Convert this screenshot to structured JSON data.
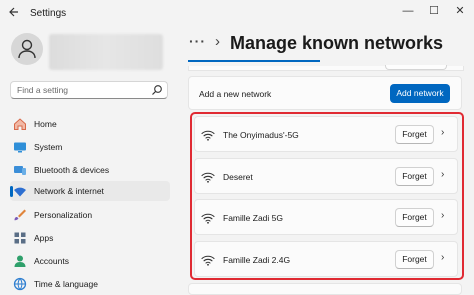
{
  "window": {
    "title": "Settings",
    "back_icon": "arrow-left-icon",
    "minimize_glyph": "—",
    "maximize_glyph": "☐",
    "close_glyph": "✕"
  },
  "search": {
    "placeholder": "Find a setting"
  },
  "sidebar": {
    "items": [
      {
        "label": "Home",
        "icon": "home-icon",
        "color": "#d86a4a"
      },
      {
        "label": "System",
        "icon": "system-icon",
        "color": "#2f8fd8"
      },
      {
        "label": "Bluetooth & devices",
        "icon": "bluetooth-icon",
        "color": "#3b8ed8"
      },
      {
        "label": "Network & internet",
        "icon": "wifi-icon",
        "color": "#2d6fd1",
        "active": true
      },
      {
        "label": "Personalization",
        "icon": "brush-icon",
        "color": "#e0843b"
      },
      {
        "label": "Apps",
        "icon": "apps-icon",
        "color": "#5a6e86"
      },
      {
        "label": "Accounts",
        "icon": "accounts-icon",
        "color": "#2fa06b"
      },
      {
        "label": "Time & language",
        "icon": "globe-icon",
        "color": "#2f7fd0"
      }
    ]
  },
  "header": {
    "breadcrumb_overflow": "···",
    "separator": "›",
    "title": "Manage known networks"
  },
  "add_network": {
    "label": "Add a new network",
    "button": "Add network"
  },
  "networks": [
    {
      "name": "The Onyimadus'-5G",
      "action": "Forget"
    },
    {
      "name": "Deseret",
      "action": "Forget"
    },
    {
      "name": "Famille Zadi 5G",
      "action": "Forget"
    },
    {
      "name": "Famille Zadi 2.4G",
      "action": "Forget"
    }
  ],
  "colors": {
    "accent": "#0067c0",
    "highlight": "#e02a33"
  }
}
